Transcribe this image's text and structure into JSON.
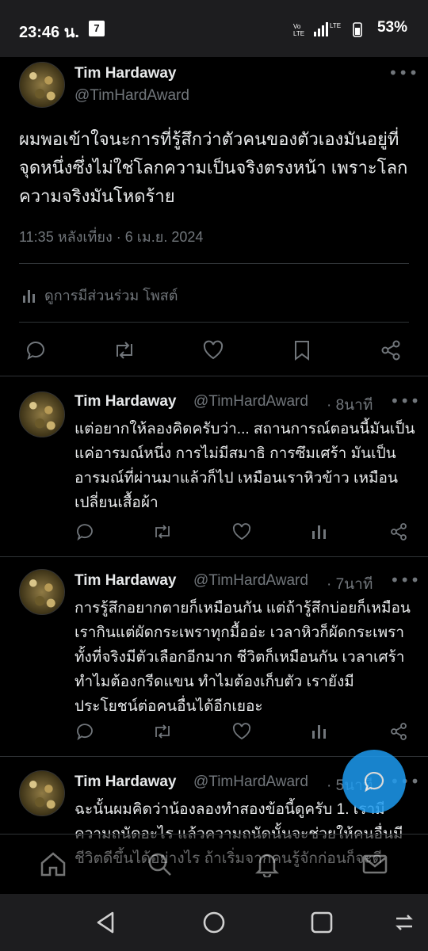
{
  "status_bar": {
    "time": "23:46 น.",
    "carrier_icon": "7",
    "network": "LTE",
    "battery": "53%"
  },
  "main_post": {
    "author_name": "Tim Hardaway",
    "author_handle": "@TimHardAward",
    "text": "ผมพอเข้าใจนะการที่รู้สึกว่าตัวคนของตัวเองมันอยู่ที่จุดหนึ่งซึ่งไม่ใช่โลกความเป็นจริงตรงหน้า เพราะโลกความจริงมันโหดร้าย",
    "timestamp": "11:35 หลังเที่ยง · 6 เม.ย. 2024",
    "engagement_label": "ดูการมีส่วนร่วม โพสต์"
  },
  "replies": [
    {
      "author_name": "Tim Hardaway",
      "author_handle": "@TimHardAward",
      "time": "· 8นาที",
      "text": "แต่อยากให้ลองคิดครับว่า... สถานการณ์ตอนนี้มันเป็นแค่อารมณ์หนึ่ง การไม่มีสมาธิ การซึมเศร้า มันเป็นอารมณ์ที่ผ่านมาแล้วก็ไป เหมือนเราหิวข้าว เหมือนเปลี่ยนเสื้อผ้า"
    },
    {
      "author_name": "Tim Hardaway",
      "author_handle": "@TimHardAward",
      "time": "· 7นาที",
      "text": "การรู้สึกอยากตายก็เหมือนกัน แต่ถ้ารู้สึกบ่อยก็เหมือนเรากินแต่ผัดกระเพราทุกมื้ออ่ะ เวลาหิวก็ผัดกระเพรา ทั้งที่จริงมีตัวเลือกอีกมาก ชีวิตก็เหมือนกัน เวลาเศร้าทำไมต้องกรีดแขน ทำไมต้องเก็บตัว เรายังมีประโยชน์ต่อคนอื่นได้อีกเยอะ"
    },
    {
      "author_name": "Tim Hardaway",
      "author_handle": "@TimHardAward",
      "time": "· 5นาที",
      "text": "ฉะนั้นผมคิดว่าน้องลองทำสองข้อนี้ดูครับ 1. เรามีความถนัดอะไร แล้วความถนัดนั้นจะช่วยให้คนอื่นมีชีวิตดีขึ้นได้อย่างไร ถ้าเริ่มจากคนรู้จักก่อนก็จะดี"
    }
  ],
  "colors": {
    "background": "#000000",
    "text": "#e7e9ea",
    "muted": "#71767b",
    "divider": "#2f3336",
    "accent": "#1d9bf0"
  }
}
